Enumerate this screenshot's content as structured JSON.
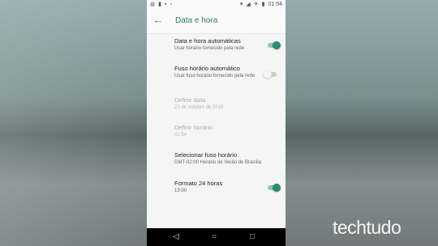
{
  "status": {
    "time": "01:54",
    "left_icons": [
      "whatsapp-icon",
      "video-icon",
      "message-icon",
      "image-icon"
    ],
    "right_icons": [
      "wifi-icon",
      "signal-icon",
      "airplane-icon",
      "battery-icon"
    ]
  },
  "appbar": {
    "title": "Data e hora"
  },
  "items": [
    {
      "title": "Data e hora automáticas",
      "subtitle": "Usar horário fornecido pela rede",
      "toggle": "on"
    },
    {
      "title": "Fuso horário automático",
      "subtitle": "Usar fuso horário fornecido pela rede",
      "toggle": "off"
    },
    {
      "title": "Definir data",
      "subtitle": "21 de outubro de 2018",
      "disabled": true
    },
    {
      "title": "Definir horário",
      "subtitle": "01:54",
      "disabled": true
    },
    {
      "title": "Selecionar fuso horário",
      "subtitle": "GMT-02:00 Horário de Verão de Brasília"
    },
    {
      "title": "Formato 24 horas",
      "subtitle": "13:00",
      "toggle": "on"
    }
  ],
  "watermark": "techtudo",
  "colors": {
    "accent": "#2e8b6e",
    "navbar": "#000000",
    "screen": "#f5f5f5"
  }
}
